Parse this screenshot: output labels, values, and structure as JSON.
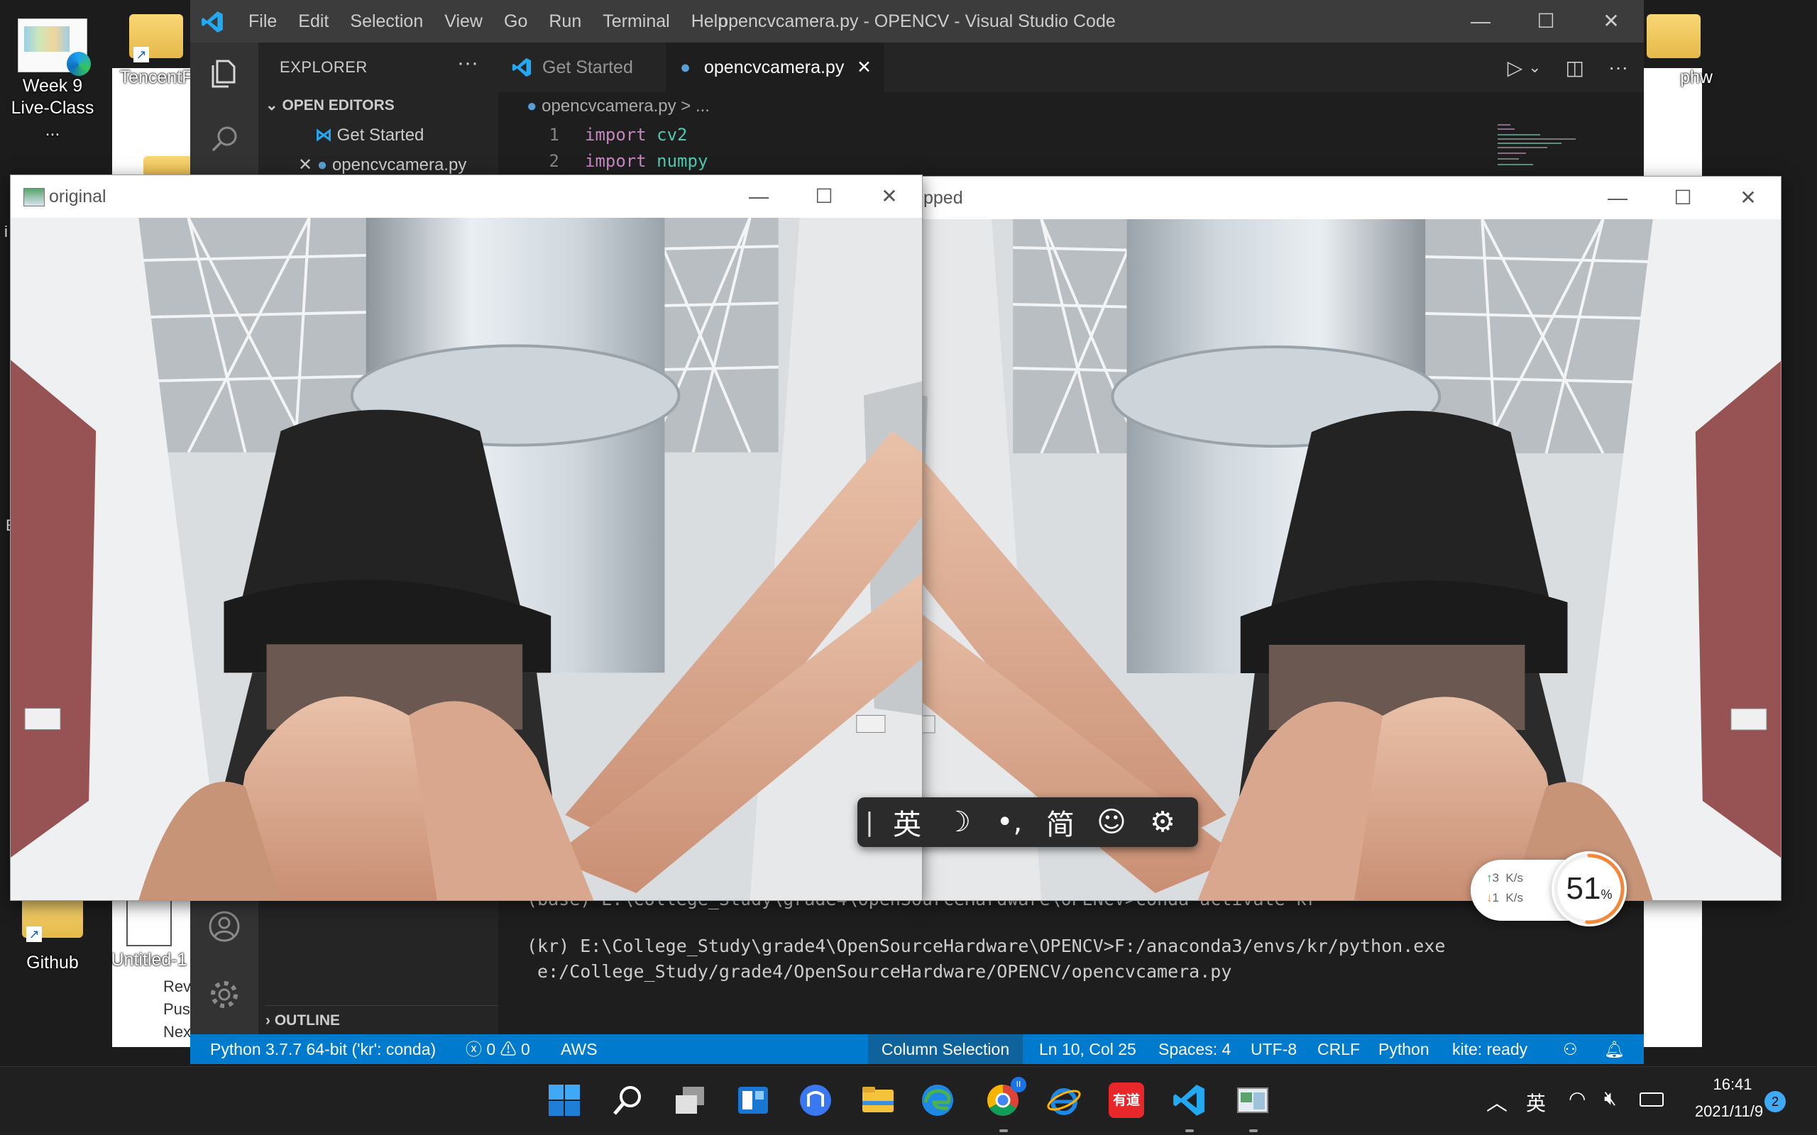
{
  "desktop": {
    "icons": [
      {
        "label": "Week 9 Live-Class ..."
      },
      {
        "label": "TencentF"
      },
      {
        "label": "Github"
      },
      {
        "label": "Untitled-1"
      },
      {
        "label": "phw"
      }
    ],
    "doc_fragments": [
      "Rev",
      "Pus",
      "Nex",
      "i",
      "E",
      "l"
    ]
  },
  "vscode": {
    "title": "opencvcamera.py - OPENCV - Visual Studio Code",
    "menu": [
      "File",
      "Edit",
      "Selection",
      "View",
      "Go",
      "Run",
      "Terminal",
      "Help"
    ],
    "window_controls": {
      "minimize": "—",
      "maximize": "☐",
      "close": "✕"
    },
    "explorer": {
      "header": "EXPLORER",
      "more": "···",
      "open_editors": "OPEN EDITORS",
      "items": [
        "Get Started",
        "opencvcamera.py"
      ],
      "outline": "OUTLINE"
    },
    "tabs": [
      {
        "label": "Get Started",
        "active": false
      },
      {
        "label": "opencvcamera.py",
        "active": true,
        "close": "✕"
      }
    ],
    "editor_actions": {
      "run": "▷",
      "run_menu": "⌄",
      "split": "◫",
      "more": "···"
    },
    "breadcrumb": {
      "file": "opencvcamera.py",
      "sep": ">",
      "rest": "..."
    },
    "code_lines": [
      {
        "num": "1",
        "kw": "import",
        "mod": "cv2"
      },
      {
        "num": "2",
        "kw": "import",
        "mod": "numpy"
      }
    ],
    "terminal_lines": [
      "(base) E:\\College_Study\\grade4\\OpenSourceHardware\\OPENCV>conda activate kr",
      "",
      "(kr) E:\\College_Study\\grade4\\OpenSourceHardware\\OPENCV>F:/anaconda3/envs/kr/python.exe",
      " e:/College_Study/grade4/OpenSourceHardware/OPENCV/opencvcamera.py"
    ],
    "statusbar": {
      "interpreter": "Python 3.7.7 64-bit ('kr': conda)",
      "errors": "0",
      "warnings": "0",
      "aws": "AWS",
      "column_selection": "Column Selection",
      "position": "Ln 10, Col 25",
      "spaces": "Spaces: 4",
      "encoding": "UTF-8",
      "eol": "CRLF",
      "language": "Python",
      "kite": "kite: ready"
    }
  },
  "cv_windows": {
    "original_title": "original",
    "flipped_title": "pped",
    "controls": {
      "minimize": "—",
      "maximize": "☐",
      "close": "✕"
    }
  },
  "ime_bar": {
    "grip": "|",
    "lang": "英",
    "moon": "☽",
    "punct": "•,",
    "charset": "简",
    "emoji": "☺",
    "settings": "⚙"
  },
  "net_widget": {
    "up": "3",
    "down": "1",
    "unit": "K/s",
    "percent": "51",
    "percent_sign": "%"
  },
  "taskbar": {
    "ime_lang": "英",
    "time": "16:41",
    "date": "2021/11/9",
    "notifications": "2",
    "chrome_badge": "II",
    "youdao_label": "有道"
  },
  "colors": {
    "vscode_blue": "#007acc",
    "accent_blue": "#0078d4",
    "gauge_orange": "#f5873b"
  }
}
